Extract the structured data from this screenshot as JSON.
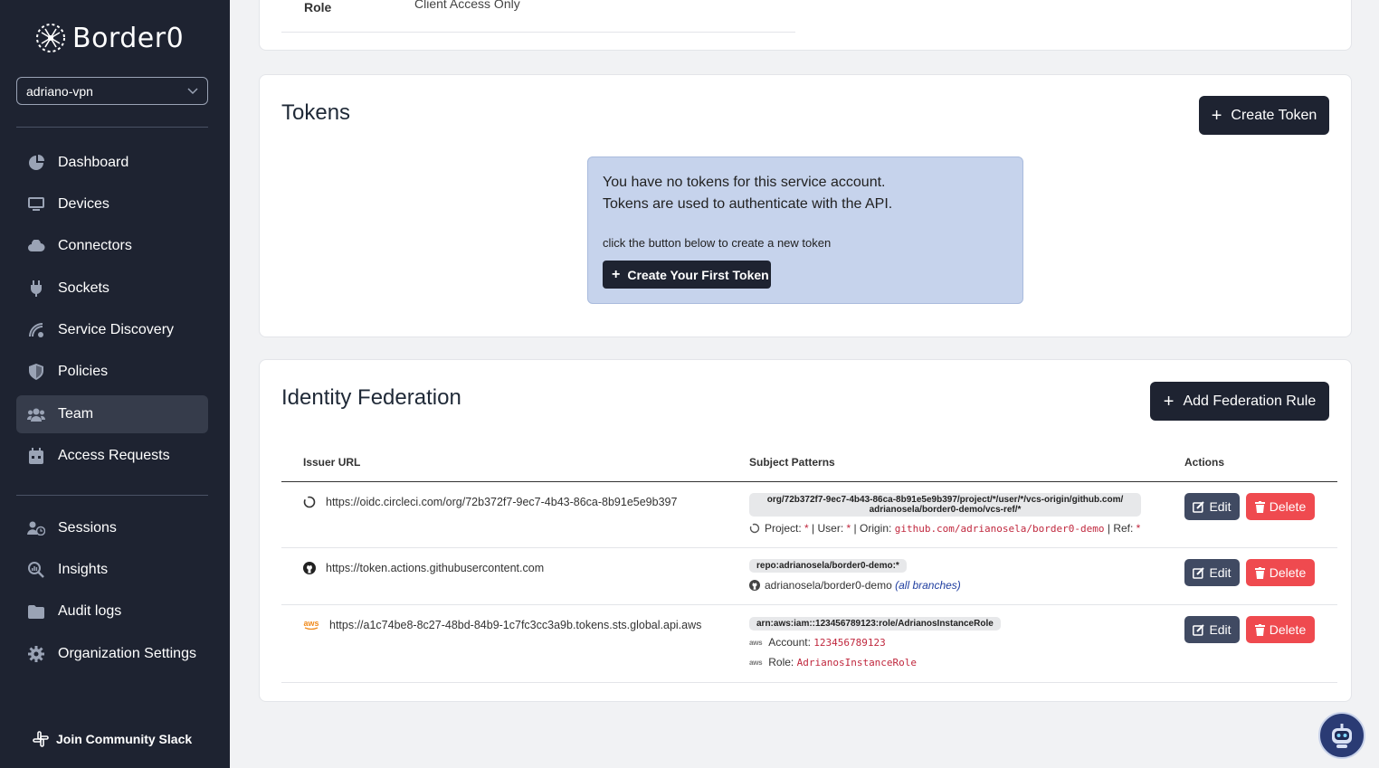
{
  "brand": {
    "name": "Border0"
  },
  "org_selector": {
    "value": "adriano-vpn"
  },
  "sidebar": {
    "items": [
      {
        "label": "Dashboard",
        "icon": "pie-chart-icon"
      },
      {
        "label": "Devices",
        "icon": "monitor-icon"
      },
      {
        "label": "Connectors",
        "icon": "cloud-icon"
      },
      {
        "label": "Sockets",
        "icon": "plug-icon"
      },
      {
        "label": "Service Discovery",
        "icon": "radar-icon"
      },
      {
        "label": "Policies",
        "icon": "shield-icon"
      },
      {
        "label": "Team",
        "icon": "users-icon",
        "active": true
      },
      {
        "label": "Access Requests",
        "icon": "calendar-icon"
      }
    ],
    "items2": [
      {
        "label": "Sessions",
        "icon": "user-clock-icon"
      },
      {
        "label": "Insights",
        "icon": "search-chart-icon"
      },
      {
        "label": "Audit logs",
        "icon": "folder-icon"
      },
      {
        "label": "Organization Settings",
        "icon": "gear-icon"
      }
    ],
    "slack": "Join Community Slack"
  },
  "role_section": {
    "label": "Role",
    "value": "Client Access Only"
  },
  "tokens": {
    "title": "Tokens",
    "create_button": "Create Token",
    "empty_line1": "You have no tokens for this service account.",
    "empty_line2": "Tokens are used to authenticate with the API.",
    "empty_hint": "click the button below to create a new token",
    "first_button": "Create Your First Token"
  },
  "federation": {
    "title": "Identity Federation",
    "add_button": "Add Federation Rule",
    "columns": [
      "Issuer URL",
      "Subject Patterns",
      "Actions"
    ],
    "edit_label": "Edit",
    "delete_label": "Delete",
    "rows": [
      {
        "issuer": "https://oidc.circleci.com/org/72b372f7-9ec7-4b43-86ca-8b91e5e9b397",
        "icon": "circleci-icon",
        "pattern_line1": "org/72b372f7-9ec7-4b43-86ca-8b91e5e9b397/project/*/user/*/vcs-origin/github.com/",
        "pattern_line2": "adrianosela/border0-demo/vcs-ref/*",
        "project_label": "Project:",
        "project_val": "*",
        "user_label": "User:",
        "user_val": "*",
        "origin_label": "Origin:",
        "origin_val": "github.com/adrianosela/border0-demo",
        "ref_label": "Ref:",
        "ref_val": "*",
        "sep": "|"
      },
      {
        "issuer": "https://token.actions.githubusercontent.com",
        "icon": "github-icon",
        "pattern": "repo:adrianosela/border0-demo:*",
        "repo": "adrianosela/border0-demo",
        "branches": "(all branches)"
      },
      {
        "issuer": "https://a1c74be8-8c27-48bd-84b9-1c7fc3cc3a9b.tokens.sts.global.api.aws",
        "icon": "aws-icon",
        "icon_text": "aws",
        "pattern": "arn:aws:iam::123456789123:role/AdrianosInstanceRole",
        "account_label": "Account:",
        "account_val": "123456789123",
        "role_label": "Role:",
        "role_val": "AdrianosInstanceRole"
      }
    ]
  },
  "colors": {
    "sidebar_bg": "#1e2331",
    "danger": "#ef4a4f",
    "edit": "#404a62",
    "info_bg": "#c6d3ec"
  }
}
